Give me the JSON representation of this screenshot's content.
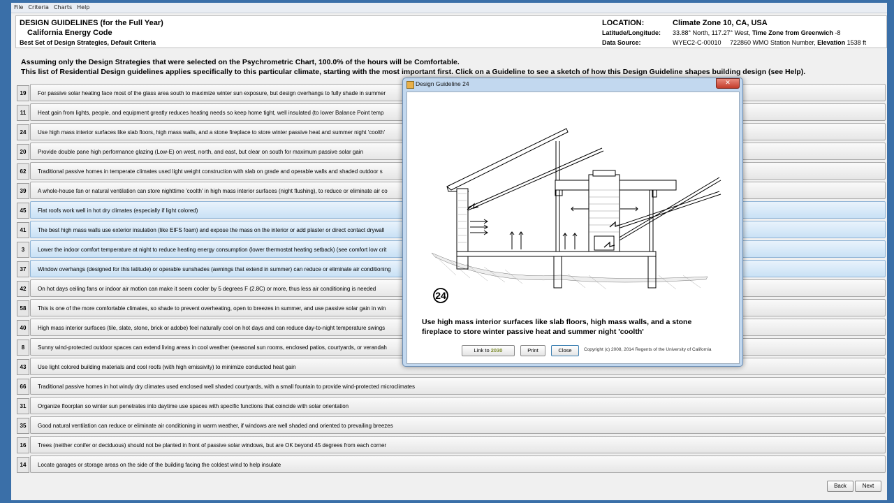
{
  "menu": [
    "File",
    "Criteria",
    "Charts",
    "Help"
  ],
  "header": {
    "title": "DESIGN GUIDELINES (for the Full Year)",
    "code": "California Energy Code",
    "strategies": "Best Set of Design Strategies, Default Criteria",
    "location_label": "LOCATION:",
    "location_value": "Climate Zone 10, CA, USA",
    "latlon_label": "Latitude/Longitude:",
    "latlon_value": "33.88° North, 117.27° West,",
    "tz_label": "Time Zone from Greenwich",
    "tz_value": "-8",
    "source_label": "Data Source:",
    "source_value": "WYEC2-C-00010     722860 WMO Station Number,",
    "elev_label": "Elevation",
    "elev_value": "1538 ft"
  },
  "summary": {
    "line1": "Assuming only the Design Strategies that were selected on the Psychrometric Chart, 100.0% of the hours will be Comfortable.",
    "line2": "This list of Residential Design guidelines applies specifically to this particular climate, starting with the most important first.  Click on a Guideline to see a sketch of how this Design Guideline shapes building design (see Help)."
  },
  "guidelines": [
    {
      "num": "19",
      "text": "For passive solar heating face most of the glass area south to maximize winter sun exposure, but design overhangs to fully shade in summer",
      "hl": false
    },
    {
      "num": "11",
      "text": "Heat gain from lights, people, and equipment greatly reduces heating needs so keep home tight, well insulated (to lower Balance Point temp",
      "hl": false
    },
    {
      "num": "24",
      "text": "Use high mass interior surfaces like slab floors, high mass walls, and a stone fireplace to store winter passive heat and summer night 'coolth'",
      "hl": false
    },
    {
      "num": "20",
      "text": "Provide double pane high performance glazing (Low-E) on west, north, and east, but clear on south for maximum passive solar gain",
      "hl": false
    },
    {
      "num": "62",
      "text": "Traditional passive homes in temperate climates used light weight construction with slab on grade and operable walls and shaded outdoor s",
      "hl": false
    },
    {
      "num": "39",
      "text": "A whole-house fan or natural ventilation can store nighttime 'coolth' in high mass interior surfaces (night flushing), to reduce or eliminate air co",
      "hl": false
    },
    {
      "num": "45",
      "text": "Flat roofs work well in hot dry climates (especially if light colored)",
      "hl": true
    },
    {
      "num": "41",
      "text": "The best high mass walls use exterior insulation (like EIFS foam) and expose the mass on the interior or add plaster or direct contact drywall",
      "hl": true
    },
    {
      "num": "3",
      "text": "Lower the indoor comfort temperature at night to reduce heating energy consumption (lower thermostat heating setback) (see comfort low crit",
      "hl": true
    },
    {
      "num": "37",
      "text": "Window overhangs (designed for this latitude) or operable sunshades (awnings that extend in summer) can reduce or eliminate air conditioning",
      "hl": true
    },
    {
      "num": "42",
      "text": "On hot days ceiling fans or indoor air motion can make it seem cooler by 5 degrees F (2.8C) or more, thus less air conditioning is needed",
      "hl": false
    },
    {
      "num": "58",
      "text": "This is one of the more comfortable climates, so shade to prevent overheating, open to breezes in summer, and use passive solar gain in win",
      "hl": false
    },
    {
      "num": "40",
      "text": "High mass interior surfaces (tile, slate, stone, brick or adobe) feel naturally cool on hot days and can reduce day-to-night temperature swings",
      "hl": false
    },
    {
      "num": "8",
      "text": "Sunny wind-protected outdoor spaces can extend living areas in cool weather (seasonal sun rooms, enclosed patios, courtyards, or verandah",
      "hl": false
    },
    {
      "num": "43",
      "text": "Use light colored building materials and cool roofs (with high emissivity) to minimize conducted heat gain",
      "hl": false
    },
    {
      "num": "66",
      "text": "Traditional passive homes in hot windy dry climates used enclosed well shaded courtyards, with a small fountain to provide wind-protected microclimates",
      "hl": false
    },
    {
      "num": "31",
      "text": "Organize floorplan so winter sun penetrates into daytime use spaces with specific functions that coincide with solar orientation",
      "hl": false
    },
    {
      "num": "35",
      "text": "Good natural ventilation can reduce or eliminate air conditioning in warm weather, if windows are well shaded and oriented to prevailing breezes",
      "hl": false
    },
    {
      "num": "16",
      "text": "Trees (neither conifer or deciduous) should not be planted in front of passive solar windows, but are OK beyond 45 degrees from each corner",
      "hl": false
    },
    {
      "num": "14",
      "text": "Locate garages or storage areas on the side of the building facing the coldest wind to help insulate",
      "hl": false
    }
  ],
  "nav": {
    "back": "Back",
    "next": "Next"
  },
  "dialog": {
    "title": "Design Guideline 24",
    "close_glyph": "✕",
    "badge": "24",
    "caption": "Use high mass interior surfaces like slab floors, high mass walls, and a stone fireplace to store winter passive heat and summer night 'coolth'",
    "link_label": "Link to",
    "link_logo": "2030",
    "print_label": "Print",
    "close_label": "Close",
    "copyright": "Copyright (c) 2008, 2014 Regents of the University of California"
  }
}
